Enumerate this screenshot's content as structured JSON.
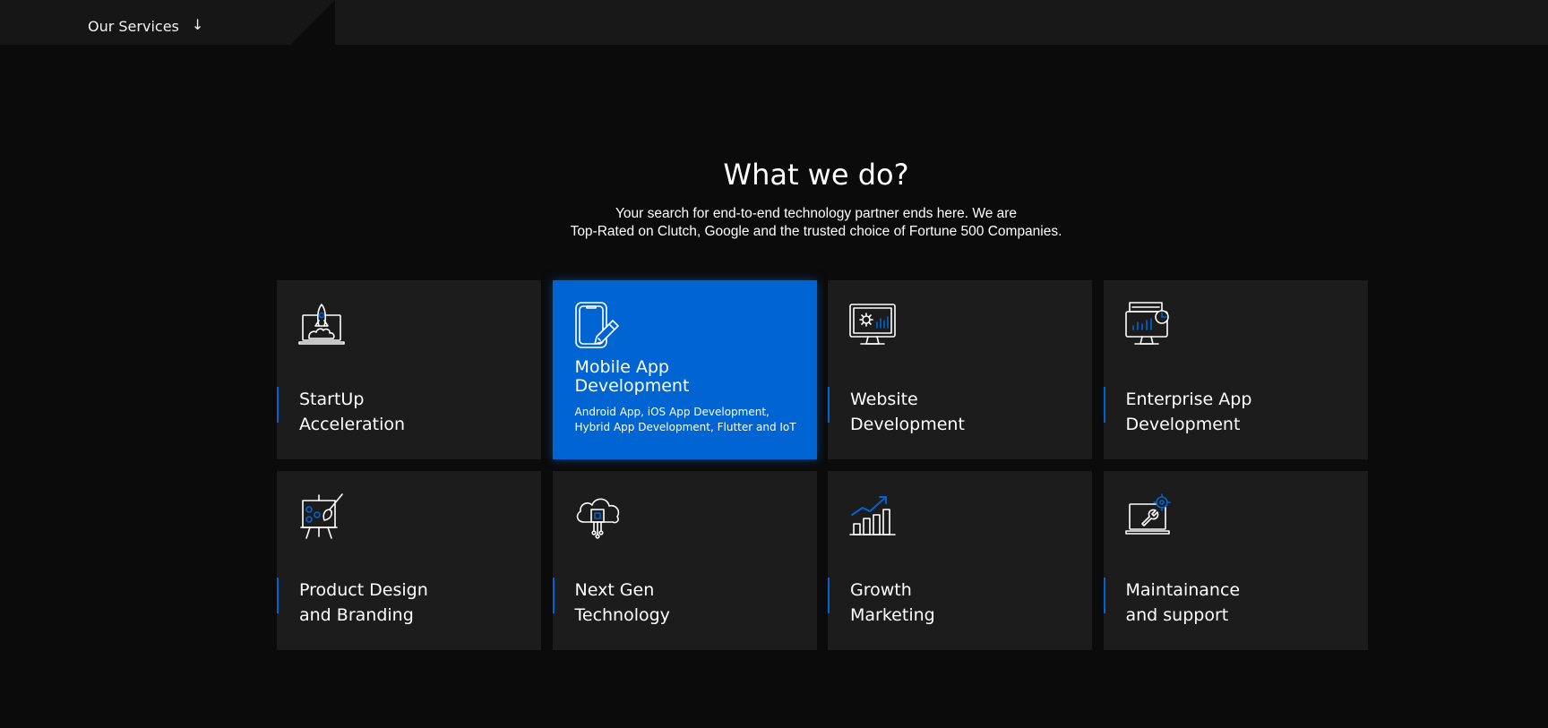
{
  "nav": {
    "services_label": "Our Services",
    "services_arrow": "↓"
  },
  "section": {
    "heading": "What we do?",
    "subtext_line1": "Your search for end-to-end technology partner ends here. We are",
    "subtext_line2": "Top-Rated on Clutch, Google and the trusted choice of Fortune 500 Companies."
  },
  "colors": {
    "accent": "#0064d2",
    "card_bg": "#1c1c1c",
    "page_bg": "#0b0b0b"
  },
  "cards": [
    {
      "line1": "StartUp",
      "line2": "Acceleration",
      "icon": "rocket-laptop-icon",
      "active": false
    },
    {
      "line1": "Mobile App",
      "line2": "Development",
      "icon": "mobile-pen-icon",
      "active": true,
      "desc": "Android App, iOS App Development, Hybrid App Development, Flutter and IoT"
    },
    {
      "line1": "Website",
      "line2": "Development",
      "icon": "monitor-gear-icon",
      "active": false
    },
    {
      "line1": "Enterprise App",
      "line2": "Development",
      "icon": "monitor-chart-icon",
      "active": false
    },
    {
      "line1": "Product Design",
      "line2": "and Branding",
      "icon": "easel-brush-icon",
      "active": false
    },
    {
      "line1": "Next Gen",
      "line2": "Technology",
      "icon": "cloud-chip-icon",
      "active": false
    },
    {
      "line1": "Growth",
      "line2": "Marketing",
      "icon": "growth-chart-icon",
      "active": false
    },
    {
      "line1": "Maintainance",
      "line2": "and support",
      "icon": "laptop-wrench-icon",
      "active": false
    }
  ]
}
